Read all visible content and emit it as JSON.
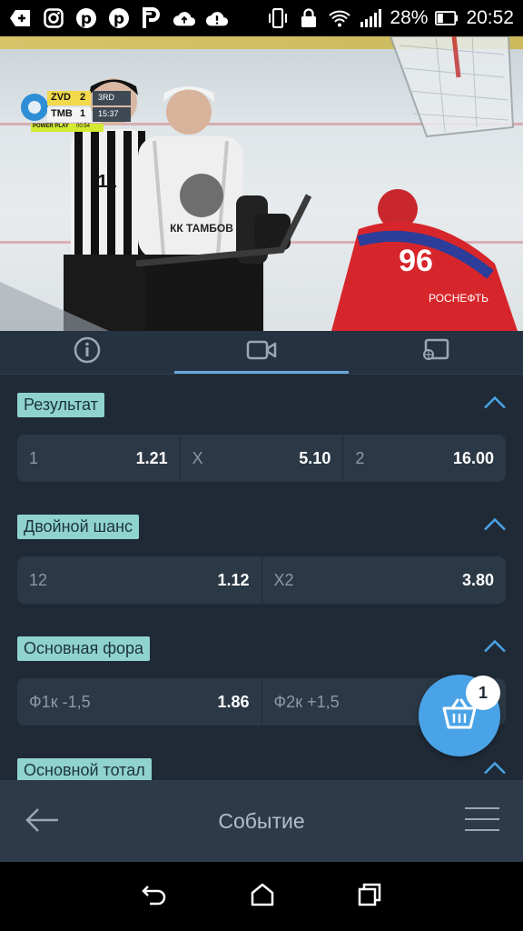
{
  "status_bar": {
    "battery": "28%",
    "time": "20:52",
    "icons": [
      "add-box-icon",
      "instagram-icon",
      "pinterest-icon",
      "pinterest-icon",
      "p-app-icon",
      "cloud-upload-icon",
      "cloud-alert-icon",
      "vibrate-icon",
      "lock-icon",
      "wifi-icon",
      "signal-icon",
      "battery-icon"
    ]
  },
  "video": {
    "score": {
      "home_team": "ZVD",
      "home_score": "2",
      "away_team": "TMB",
      "away_score": "1",
      "period": "3RD",
      "clock": "15:37",
      "power_play": "POWER PLAY",
      "pp_time": "00:54"
    }
  },
  "tabs": [
    {
      "icon": "info-icon"
    },
    {
      "icon": "video-camera-icon",
      "active": true
    },
    {
      "icon": "cast-icon"
    }
  ],
  "markets": [
    {
      "title": "Результат",
      "odds": [
        {
          "label": "1",
          "value": "1.21"
        },
        {
          "label": "X",
          "value": "5.10"
        },
        {
          "label": "2",
          "value": "16.00"
        }
      ]
    },
    {
      "title": "Двойной шанс",
      "odds": [
        {
          "label": "12",
          "value": "1.12"
        },
        {
          "label": "X2",
          "value": "3.80"
        }
      ]
    },
    {
      "title": "Основная фора",
      "odds": [
        {
          "label": "Ф1к -1,5",
          "value": "1.86"
        },
        {
          "label": "Ф2к +1,5",
          "value": ""
        }
      ]
    },
    {
      "title": "Основной тотал",
      "odds": []
    }
  ],
  "basket": {
    "count": "1"
  },
  "bottom_bar": {
    "title": "Событие"
  },
  "colors": {
    "accent": "#4aa3e6",
    "section_tag": "#8fd2cf",
    "background": "#1f2a36",
    "row": "#2b3846"
  }
}
